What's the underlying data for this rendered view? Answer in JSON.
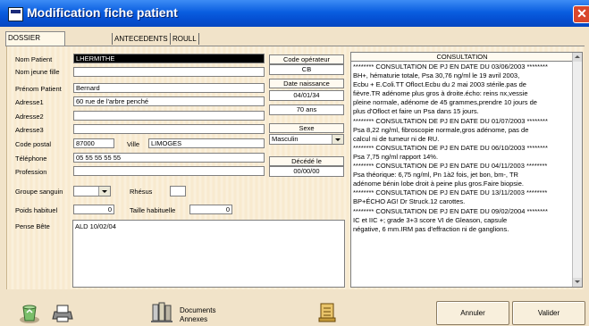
{
  "window": {
    "title": "Modification fiche patient"
  },
  "tabs": [
    {
      "label": "DOSSIER ADMINISTRATIF"
    },
    {
      "label": "ANTECEDENTS"
    },
    {
      "label": "ROULL"
    }
  ],
  "fields": {
    "nom": {
      "label": "Nom Patient",
      "value": "LHERMITHE"
    },
    "nom_jeune_fille": {
      "label": "Nom jeune fille",
      "value": ""
    },
    "prenom": {
      "label": "Prénom Patient",
      "value": "Bernard"
    },
    "adresse1": {
      "label": "Adresse1",
      "value": "60 rue de l'arbre penché"
    },
    "adresse2": {
      "label": "Adresse2",
      "value": ""
    },
    "adresse3": {
      "label": "Adresse3",
      "value": ""
    },
    "code_postal": {
      "label": "Code postal",
      "value": "87000"
    },
    "ville": {
      "label": "Ville",
      "value": "LIMOGES"
    },
    "telephone": {
      "label": "Téléphone",
      "value": "05 55 55 55 55"
    },
    "profession": {
      "label": "Profession",
      "value": ""
    },
    "groupe_sanguin": {
      "label": "Groupe sanguin",
      "value": ""
    },
    "rhesus": {
      "label": "Rhésus",
      "value": ""
    },
    "poids": {
      "label": "Poids habituel",
      "value": "0"
    },
    "taille": {
      "label": "Taille habituelle",
      "value": "0"
    },
    "pense_bete": {
      "label": "Pense Bête",
      "value": "ALD 10/02/04"
    }
  },
  "side": {
    "code_operateur_label": "Code opérateur",
    "code_operateur": "CB",
    "date_naissance_label": "Date naissance",
    "date_naissance": "04/01/34",
    "age": "70 ans",
    "sexe_label": "Sexe",
    "sexe": "Masculin",
    "decede_label": "Décédé le",
    "decede": "00/00/00"
  },
  "consultation": {
    "header": "CONSULTATION",
    "text": "******** CONSULTATION DE PJ EN DATE DU 03/06/2003 ********\nBH+, hématurie totale, Psa 30,76 ng/ml le 19 avril 2003,\nEcbu + E.Coli.TT Ofloct.Ecbu du 2 mai 2003 stérile.pas de\nfièvre.TR adénome plus gros à droite.écho: reins nx,vessie\npleine normale, adénome de 45 grammes,prendre 10 jours de\nplus d'Ofloct et faire un Psa dans 15 jours.\n******** CONSULTATION DE PJ EN DATE DU 01/07/2003 ********\nPsa 8,22 ng/ml, fibroscopie normale,gros adénome, pas de\ncalcul ni de tumeur ni de RU.\n******** CONSULTATION DE PJ EN DATE DU 06/10/2003 ********\nPsa 7,75 ng/ml rapport 14%.\n******** CONSULTATION DE PJ EN DATE DU 04/11/2003 ********\nPsa théorique: 6,75 ng/ml, Pn 1à2 fois, jet bon, bm-, TR\nadénome bénin lobe droit à peine plus gros.Faire biopsie.\n******** CONSULTATION DE PJ EN DATE DU 13/11/2003 ********\nBP+ÉCHO AG! Dr Struck.12 carottes.\n******** CONSULTATION DE PJ EN DATE DU 09/02/2004 ********\nIC et IIC +; grade 3+3 score VI de Gleason, capsule\nnégative, 6 mm.IRM pas d'effraction ni de ganglions."
  },
  "toolbar": {
    "documents_label": "Documents",
    "annexes_label": "Annexes",
    "annuler_label": "Annuler",
    "valider_label": "Valider"
  }
}
